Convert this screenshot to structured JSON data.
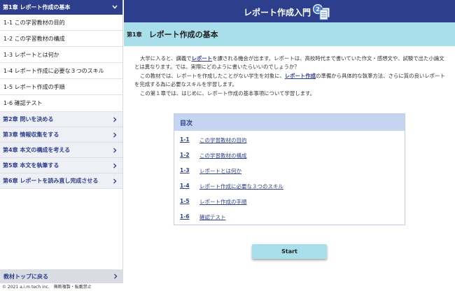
{
  "sidebar": {
    "active_chapter": "第1章 レポート作成の基本",
    "sub_items": [
      "1-1 この学習教材の目的",
      "1-2 この学習教材の構成",
      "1-3 レポートとは何か",
      "1-4 レポート作成に必要な３つのスキル",
      "1-5 レポート作成の手順",
      "1-6 確認テスト"
    ],
    "chapters": [
      "第2章 問いを決める",
      "第3章 情報収集をする",
      "第4章 本文の構成を考える",
      "第5章 本文を執筆する",
      "第6章 レポートを読み直し完成させる"
    ],
    "bottom_link": "教材トップに戻る",
    "copyright": "© 2021 a.i.m tech inc.　無断複製・転載禁止"
  },
  "header": {
    "title": "レポート作成入門",
    "icon_number": "2"
  },
  "chapter": {
    "number": "第1章",
    "title": "レポート作成の基本"
  },
  "intro": {
    "p1_a": "大学に入ると、講義で",
    "p1_link": "レポート",
    "p1_b": "を課される機会が出ます。レポートは、高校時代まで書いていた作文・感想文や、試験で出た小論文とは異なります。では、実際にどのように書いたらいいのでしょうか？",
    "p2_a": "この教材では、レポートを作成したことがない学生を対象に、",
    "p2_link": "レポート作成",
    "p2_b": "の準備から具体的な執筆方法、さらに質の良いレポートを完成する為に必要なスキルを学習します。",
    "p3": "この第１章では、はじめに、レポート作成の基本事項について学習します。"
  },
  "toc": {
    "heading": "目次",
    "items": [
      {
        "num": "1-1",
        "label": "この学習教材の目的"
      },
      {
        "num": "1-2",
        "label": "この学習教材の構成"
      },
      {
        "num": "1-3",
        "label": "レポートとは何か"
      },
      {
        "num": "1-4",
        "label": "レポート作成に必要な３つのスキル"
      },
      {
        "num": "1-5",
        "label": "レポート作成の手順"
      },
      {
        "num": "1-6",
        "label": "確認テスト"
      }
    ]
  },
  "start_button": "Start",
  "colors": {
    "navy": "#2d3f8c",
    "light_blue": "#a9deeb",
    "toc_head": "#c5d4f1"
  }
}
